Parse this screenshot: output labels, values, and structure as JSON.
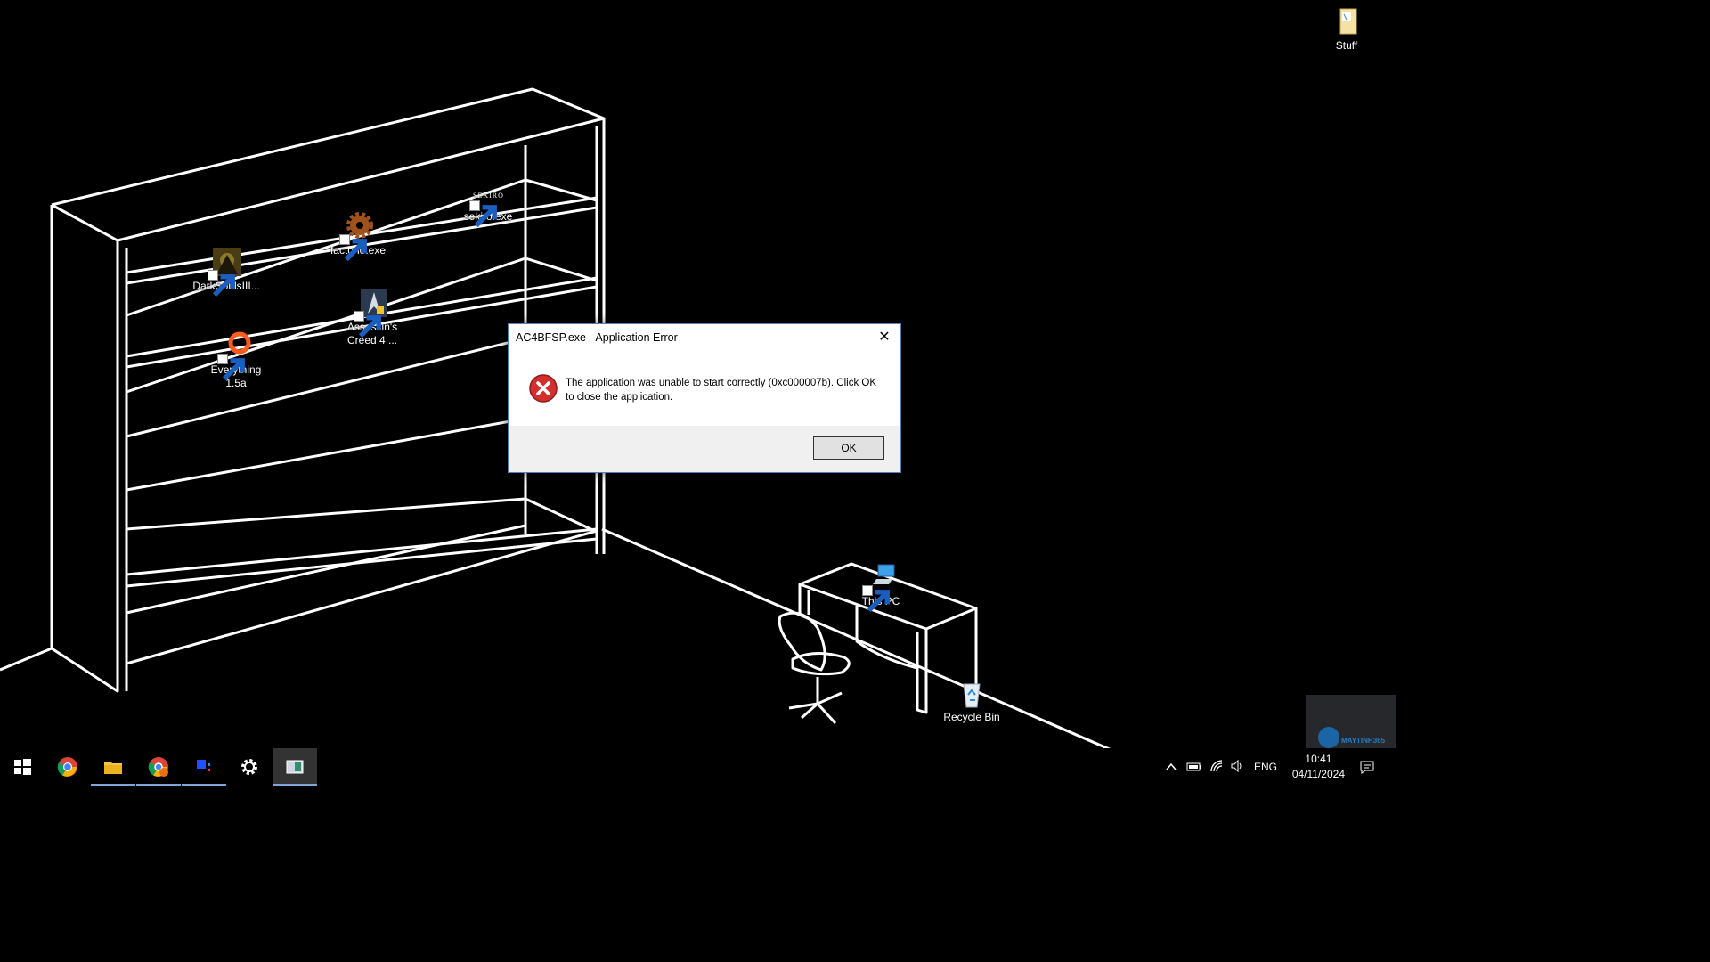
{
  "desktop": {
    "icons": [
      {
        "label": "Stuff",
        "icon": "folder-icon"
      },
      {
        "label": "sekiro.exe",
        "icon": "sekiro-icon",
        "icon_text": "SEKIRO"
      },
      {
        "label": "factorio.exe",
        "icon": "factorio-gear-icon"
      },
      {
        "label": "DarkSoulsIII...",
        "icon": "darksouls-icon"
      },
      {
        "label": "Assassin's Creed 4 ...",
        "icon": "assassins-creed-icon"
      },
      {
        "label": "Everything 1.5a",
        "icon": "everything-icon"
      },
      {
        "label": "This PC",
        "icon": "this-pc-icon"
      },
      {
        "label": "Recycle Bin",
        "icon": "recycle-bin-icon"
      }
    ]
  },
  "dialog": {
    "title": "AC4BFSP.exe - Application Error",
    "message": "The application was unable to start correctly (0xc000007b). Click OK to close the application.",
    "ok_label": "OK",
    "close_glyph": "✕"
  },
  "taskbar": {
    "apps": [
      {
        "name": "start-button",
        "icon": "windows-logo-icon"
      },
      {
        "name": "chrome",
        "icon": "chrome-icon"
      },
      {
        "name": "file-explorer",
        "icon": "folder-icon"
      },
      {
        "name": "chrome-profile",
        "icon": "chrome-profile-icon"
      },
      {
        "name": "app",
        "icon": "blue-squares-icon"
      },
      {
        "name": "settings",
        "icon": "gear-icon"
      },
      {
        "name": "active-window",
        "icon": "window-icon"
      }
    ],
    "tray": {
      "language": "ENG",
      "time": "10:41",
      "date": "04/11/2024"
    }
  },
  "watermark": {
    "text": "MAYTINH365"
  },
  "colors": {
    "background": "#000000",
    "dialog_border": "#5b7fb0",
    "error_red": "#d32f2f"
  }
}
